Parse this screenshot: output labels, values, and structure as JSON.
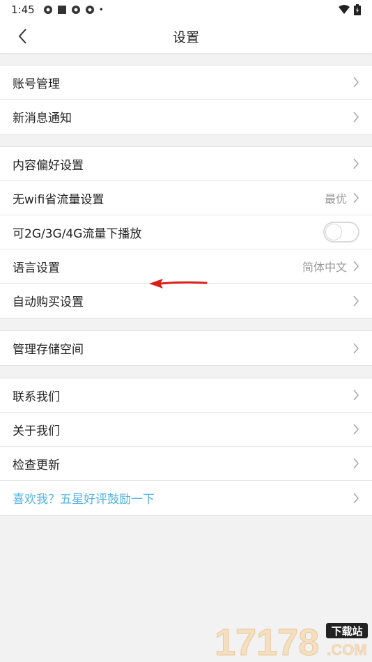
{
  "statusbar": {
    "time": "1:45",
    "dot": "•"
  },
  "header": {
    "title": "设置"
  },
  "groups": [
    {
      "items": [
        {
          "label": "账号管理"
        },
        {
          "label": "新消息通知"
        }
      ]
    },
    {
      "items": [
        {
          "label": "内容偏好设置"
        },
        {
          "label": "无wifi省流量设置",
          "value": "最优"
        },
        {
          "label": "可2G/3G/4G流量下播放",
          "toggle": false
        },
        {
          "label": "语言设置",
          "value": "简体中文"
        },
        {
          "label": "自动购买设置"
        }
      ]
    },
    {
      "items": [
        {
          "label": "管理存储空间"
        }
      ]
    },
    {
      "items": [
        {
          "label": "联系我们"
        },
        {
          "label": "关于我们"
        },
        {
          "label": "检查更新"
        },
        {
          "label": "喜欢我？五星好评鼓励一下"
        }
      ]
    }
  ],
  "watermark": {
    "text": "17178",
    "badge": "下载站",
    "domain": ".COM"
  },
  "colors": {
    "link": "#4fb3e8",
    "annotation_arrow": "#d9201d"
  }
}
